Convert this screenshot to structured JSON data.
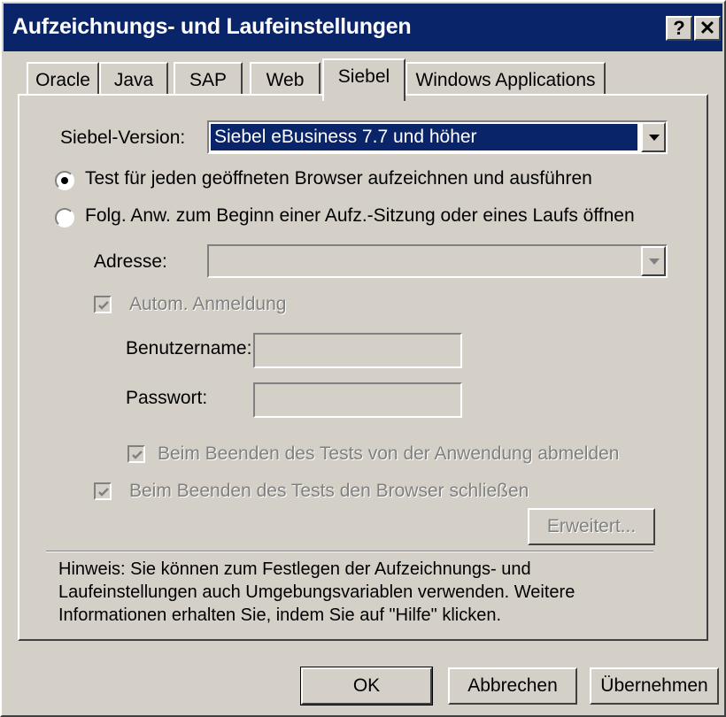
{
  "window": {
    "title": "Aufzeichnungs- und Laufeinstellungen",
    "help_glyph": "?",
    "close_glyph": "✕"
  },
  "tabs": [
    {
      "label": "Oracle"
    },
    {
      "label": "Java"
    },
    {
      "label": "SAP"
    },
    {
      "label": "Web"
    },
    {
      "label": "Siebel",
      "active": true
    },
    {
      "label": "Windows Applications"
    }
  ],
  "siebel": {
    "version_label": "Siebel-Version:",
    "version_value": "Siebel eBusiness 7.7 und höher",
    "radio_any_browser": "Test für jeden geöffneten Browser aufzeichnen und ausführen",
    "radio_open_app": "Folg. Anw. zum Beginn einer Aufz.-Sitzung oder eines Laufs öffnen",
    "address_label": "Adresse:",
    "address_value": "",
    "auto_login_label": "Autom. Anmeldung",
    "username_label": "Benutzername:",
    "password_label": "Passwort:",
    "logout_label": "Beim Beenden des Tests von der Anwendung abmelden",
    "close_browser_label": "Beim Beenden des Tests den Browser schließen",
    "advanced_button": "Erweitert...",
    "note": "Hinweis: Sie können zum Festlegen der Aufzeichnungs- und Laufeinstellungen auch Umgebungsvariablen verwenden. Weitere Informationen erhalten Sie, indem Sie auf \"Hilfe\" klicken."
  },
  "footer": {
    "ok": "OK",
    "cancel": "Abbrechen",
    "apply": "Übernehmen"
  },
  "colors": {
    "titlebar": "#0a246a",
    "face": "#d4d0c8",
    "disabled_text": "#808080"
  }
}
